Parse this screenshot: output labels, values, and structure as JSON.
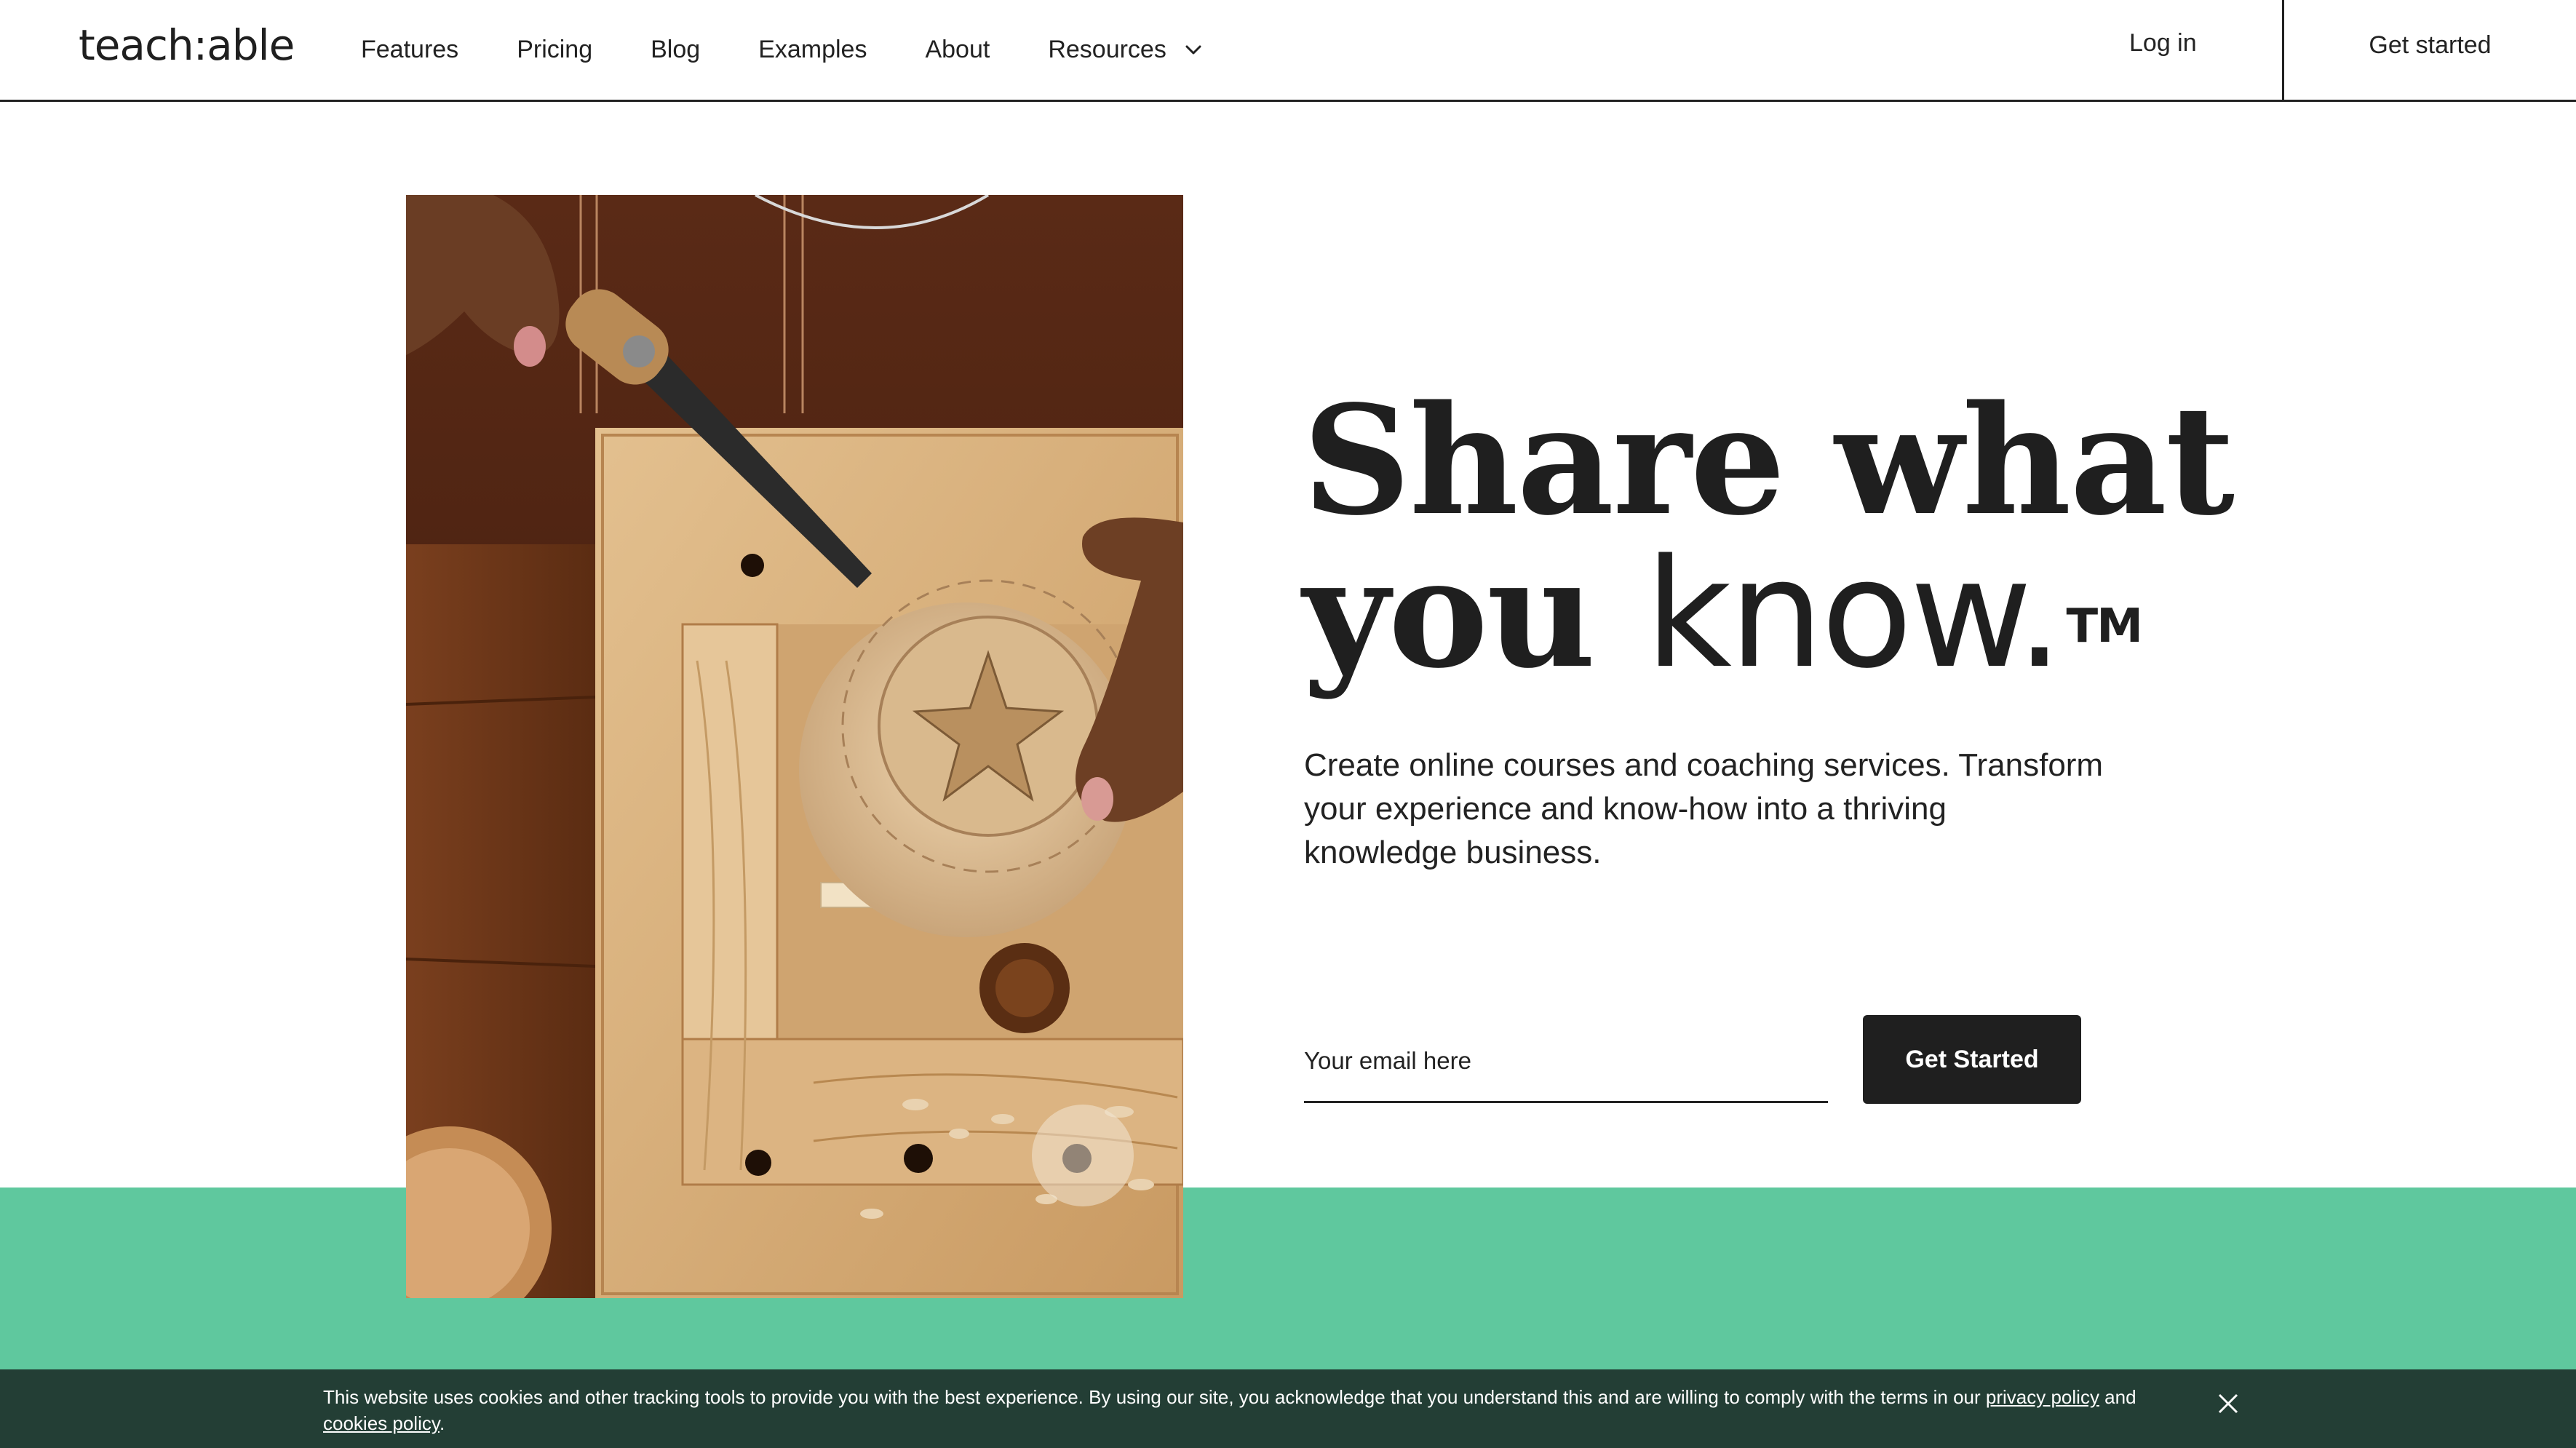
{
  "header": {
    "logo": "teach:able",
    "nav": [
      {
        "label": "Features"
      },
      {
        "label": "Pricing"
      },
      {
        "label": "Blog"
      },
      {
        "label": "Examples"
      },
      {
        "label": "About"
      },
      {
        "label": "Resources"
      }
    ],
    "login_label": "Log in",
    "get_started_label": "Get started"
  },
  "hero": {
    "headline_line1": "Share what",
    "headline_you": "you ",
    "headline_know": "know.",
    "headline_tm": "TM",
    "subtext": "Create online courses and coaching services. Transform your experience and know-how into a thriving knowledge business.",
    "email_placeholder": "Your email here",
    "cta_label": "Get Started"
  },
  "cookie_banner": {
    "text_before": "This website uses cookies and other tracking tools to provide you with the best experience. By using our site, you acknowledge that you understand this and are willing to comply with the terms in our ",
    "privacy_link": "privacy policy",
    "text_middle": " and ",
    "cookies_link": "cookies policy",
    "text_after": "."
  },
  "colors": {
    "accent_green": "#5fc89e",
    "cookie_bg": "#233e35",
    "dark": "#1f1f1f"
  },
  "icons": {
    "resources_dropdown": "chevron-down-icon",
    "cookie_close": "close-icon"
  }
}
